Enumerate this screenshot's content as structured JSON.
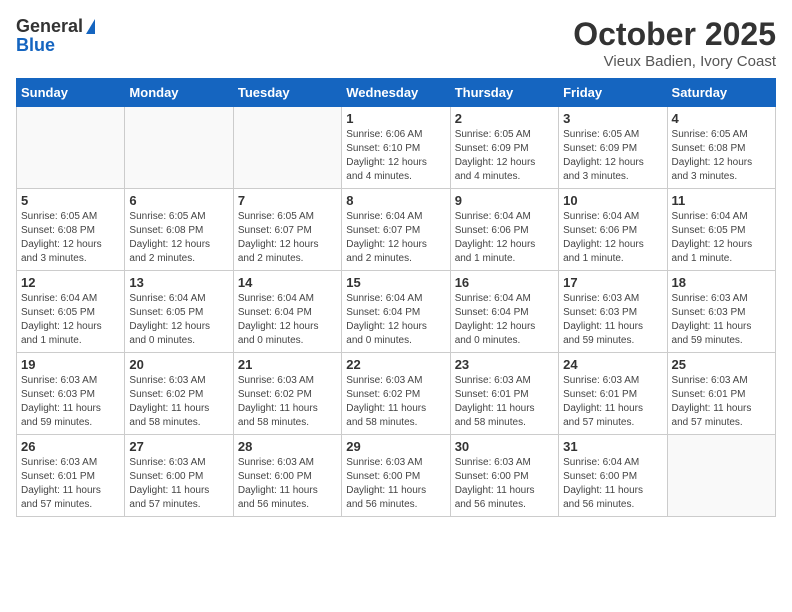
{
  "header": {
    "logo_general": "General",
    "logo_blue": "Blue",
    "month": "October 2025",
    "location": "Vieux Badien, Ivory Coast"
  },
  "weekdays": [
    "Sunday",
    "Monday",
    "Tuesday",
    "Wednesday",
    "Thursday",
    "Friday",
    "Saturday"
  ],
  "weeks": [
    [
      {
        "day": "",
        "info": ""
      },
      {
        "day": "",
        "info": ""
      },
      {
        "day": "",
        "info": ""
      },
      {
        "day": "1",
        "info": "Sunrise: 6:06 AM\nSunset: 6:10 PM\nDaylight: 12 hours\nand 4 minutes."
      },
      {
        "day": "2",
        "info": "Sunrise: 6:05 AM\nSunset: 6:09 PM\nDaylight: 12 hours\nand 4 minutes."
      },
      {
        "day": "3",
        "info": "Sunrise: 6:05 AM\nSunset: 6:09 PM\nDaylight: 12 hours\nand 3 minutes."
      },
      {
        "day": "4",
        "info": "Sunrise: 6:05 AM\nSunset: 6:08 PM\nDaylight: 12 hours\nand 3 minutes."
      }
    ],
    [
      {
        "day": "5",
        "info": "Sunrise: 6:05 AM\nSunset: 6:08 PM\nDaylight: 12 hours\nand 3 minutes."
      },
      {
        "day": "6",
        "info": "Sunrise: 6:05 AM\nSunset: 6:08 PM\nDaylight: 12 hours\nand 2 minutes."
      },
      {
        "day": "7",
        "info": "Sunrise: 6:05 AM\nSunset: 6:07 PM\nDaylight: 12 hours\nand 2 minutes."
      },
      {
        "day": "8",
        "info": "Sunrise: 6:04 AM\nSunset: 6:07 PM\nDaylight: 12 hours\nand 2 minutes."
      },
      {
        "day": "9",
        "info": "Sunrise: 6:04 AM\nSunset: 6:06 PM\nDaylight: 12 hours\nand 1 minute."
      },
      {
        "day": "10",
        "info": "Sunrise: 6:04 AM\nSunset: 6:06 PM\nDaylight: 12 hours\nand 1 minute."
      },
      {
        "day": "11",
        "info": "Sunrise: 6:04 AM\nSunset: 6:05 PM\nDaylight: 12 hours\nand 1 minute."
      }
    ],
    [
      {
        "day": "12",
        "info": "Sunrise: 6:04 AM\nSunset: 6:05 PM\nDaylight: 12 hours\nand 1 minute."
      },
      {
        "day": "13",
        "info": "Sunrise: 6:04 AM\nSunset: 6:05 PM\nDaylight: 12 hours\nand 0 minutes."
      },
      {
        "day": "14",
        "info": "Sunrise: 6:04 AM\nSunset: 6:04 PM\nDaylight: 12 hours\nand 0 minutes."
      },
      {
        "day": "15",
        "info": "Sunrise: 6:04 AM\nSunset: 6:04 PM\nDaylight: 12 hours\nand 0 minutes."
      },
      {
        "day": "16",
        "info": "Sunrise: 6:04 AM\nSunset: 6:04 PM\nDaylight: 12 hours\nand 0 minutes."
      },
      {
        "day": "17",
        "info": "Sunrise: 6:03 AM\nSunset: 6:03 PM\nDaylight: 11 hours\nand 59 minutes."
      },
      {
        "day": "18",
        "info": "Sunrise: 6:03 AM\nSunset: 6:03 PM\nDaylight: 11 hours\nand 59 minutes."
      }
    ],
    [
      {
        "day": "19",
        "info": "Sunrise: 6:03 AM\nSunset: 6:03 PM\nDaylight: 11 hours\nand 59 minutes."
      },
      {
        "day": "20",
        "info": "Sunrise: 6:03 AM\nSunset: 6:02 PM\nDaylight: 11 hours\nand 58 minutes."
      },
      {
        "day": "21",
        "info": "Sunrise: 6:03 AM\nSunset: 6:02 PM\nDaylight: 11 hours\nand 58 minutes."
      },
      {
        "day": "22",
        "info": "Sunrise: 6:03 AM\nSunset: 6:02 PM\nDaylight: 11 hours\nand 58 minutes."
      },
      {
        "day": "23",
        "info": "Sunrise: 6:03 AM\nSunset: 6:01 PM\nDaylight: 11 hours\nand 58 minutes."
      },
      {
        "day": "24",
        "info": "Sunrise: 6:03 AM\nSunset: 6:01 PM\nDaylight: 11 hours\nand 57 minutes."
      },
      {
        "day": "25",
        "info": "Sunrise: 6:03 AM\nSunset: 6:01 PM\nDaylight: 11 hours\nand 57 minutes."
      }
    ],
    [
      {
        "day": "26",
        "info": "Sunrise: 6:03 AM\nSunset: 6:01 PM\nDaylight: 11 hours\nand 57 minutes."
      },
      {
        "day": "27",
        "info": "Sunrise: 6:03 AM\nSunset: 6:00 PM\nDaylight: 11 hours\nand 57 minutes."
      },
      {
        "day": "28",
        "info": "Sunrise: 6:03 AM\nSunset: 6:00 PM\nDaylight: 11 hours\nand 56 minutes."
      },
      {
        "day": "29",
        "info": "Sunrise: 6:03 AM\nSunset: 6:00 PM\nDaylight: 11 hours\nand 56 minutes."
      },
      {
        "day": "30",
        "info": "Sunrise: 6:03 AM\nSunset: 6:00 PM\nDaylight: 11 hours\nand 56 minutes."
      },
      {
        "day": "31",
        "info": "Sunrise: 6:04 AM\nSunset: 6:00 PM\nDaylight: 11 hours\nand 56 minutes."
      },
      {
        "day": "",
        "info": ""
      }
    ]
  ]
}
